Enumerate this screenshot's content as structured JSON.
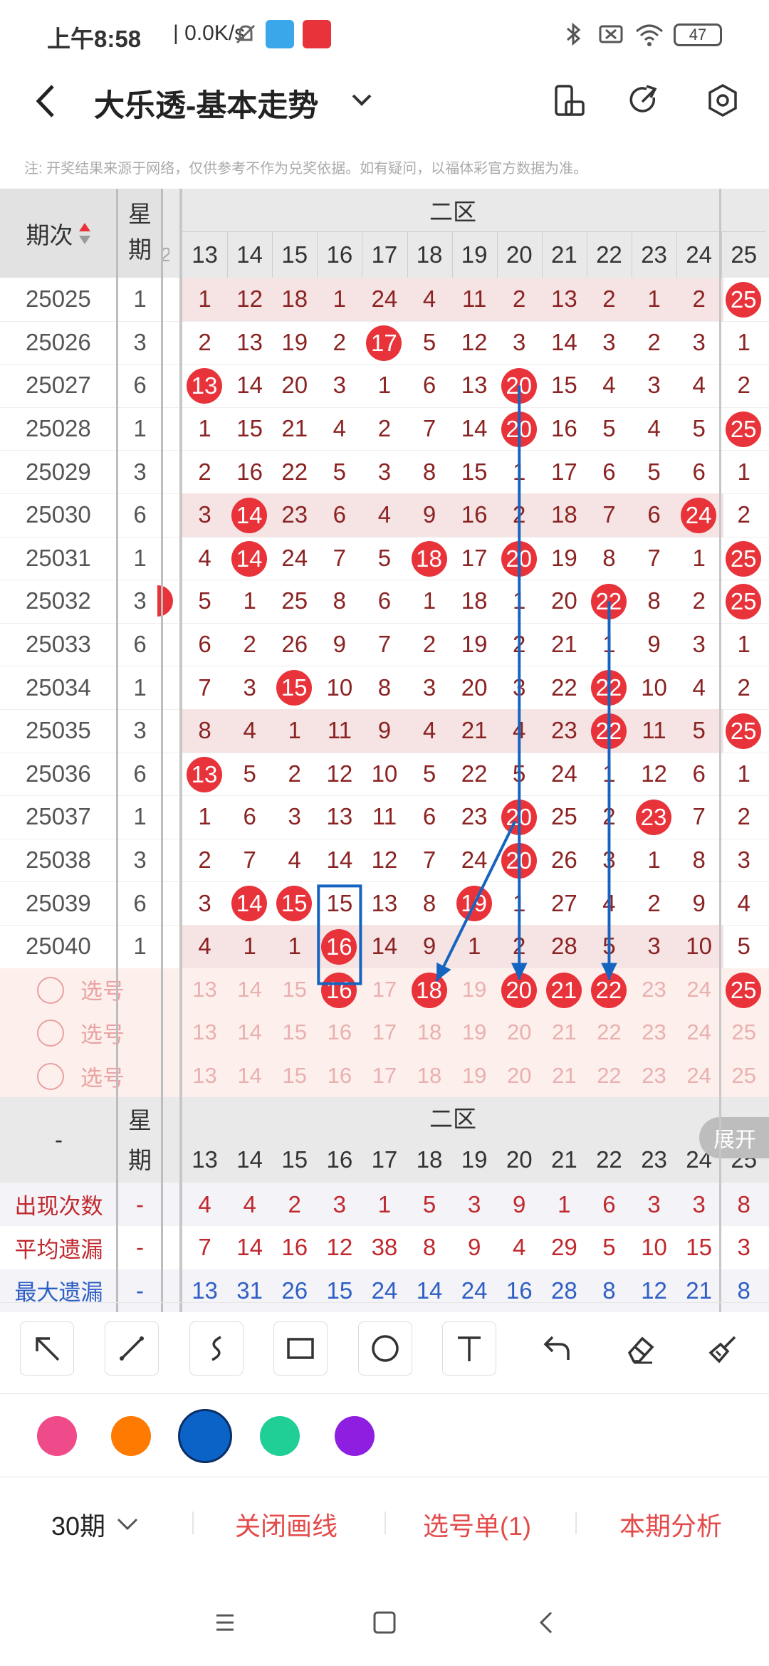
{
  "status": {
    "time": "上午8:58",
    "net": "| 0.0K/s",
    "battery": "47"
  },
  "header": {
    "title": "大乐透-基本走势"
  },
  "notice": "注: 开奖结果来源于网络，仅供参考不作为兑奖依据。如有疑问，以福体彩官方数据为准。",
  "table": {
    "col_period": "期次",
    "col_week_top": "星",
    "col_week_bottom": "期",
    "zone_label": "二区",
    "edge_left": "2",
    "columns": [
      "13",
      "14",
      "15",
      "16",
      "17",
      "18",
      "19",
      "20",
      "21",
      "22",
      "23",
      "24",
      "25"
    ],
    "rows": [
      {
        "period": "25025",
        "week": "1",
        "cells": [
          "1",
          "12",
          "18",
          "1",
          "24",
          "4",
          "11",
          "2",
          "13",
          "2",
          "1",
          "2",
          "25"
        ],
        "hits": [
          12
        ]
      },
      {
        "period": "25026",
        "week": "3",
        "cells": [
          "2",
          "13",
          "19",
          "2",
          "17",
          "5",
          "12",
          "3",
          "14",
          "3",
          "2",
          "3",
          "1"
        ],
        "hits": [
          4
        ]
      },
      {
        "period": "25027",
        "week": "6",
        "cells": [
          "13",
          "14",
          "20",
          "3",
          "1",
          "6",
          "13",
          "20",
          "15",
          "4",
          "3",
          "4",
          "2"
        ],
        "hits": [
          0,
          7
        ]
      },
      {
        "period": "25028",
        "week": "1",
        "cells": [
          "1",
          "15",
          "21",
          "4",
          "2",
          "7",
          "14",
          "20",
          "16",
          "5",
          "4",
          "5",
          "25"
        ],
        "hits": [
          7,
          12
        ]
      },
      {
        "period": "25029",
        "week": "3",
        "cells": [
          "2",
          "16",
          "22",
          "5",
          "3",
          "8",
          "15",
          "1",
          "17",
          "6",
          "5",
          "6",
          "1"
        ],
        "hits": []
      },
      {
        "period": "25030",
        "week": "6",
        "cells": [
          "3",
          "14",
          "23",
          "6",
          "4",
          "9",
          "16",
          "2",
          "18",
          "7",
          "6",
          "24",
          "2"
        ],
        "hits": [
          1,
          11
        ]
      },
      {
        "period": "25031",
        "week": "1",
        "cells": [
          "4",
          "14",
          "24",
          "7",
          "5",
          "18",
          "17",
          "20",
          "19",
          "8",
          "7",
          "1",
          "25"
        ],
        "hits": [
          1,
          5,
          7,
          12
        ]
      },
      {
        "period": "25032",
        "week": "3",
        "cells": [
          "5",
          "1",
          "25",
          "8",
          "6",
          "1",
          "18",
          "1",
          "20",
          "22",
          "8",
          "2",
          "25"
        ],
        "hits": [
          9,
          12
        ],
        "edge_hit": true
      },
      {
        "period": "25033",
        "week": "6",
        "cells": [
          "6",
          "2",
          "26",
          "9",
          "7",
          "2",
          "19",
          "2",
          "21",
          "1",
          "9",
          "3",
          "1"
        ],
        "hits": []
      },
      {
        "period": "25034",
        "week": "1",
        "cells": [
          "7",
          "3",
          "15",
          "10",
          "8",
          "3",
          "20",
          "3",
          "22",
          "22",
          "10",
          "4",
          "2"
        ],
        "hits": [
          2,
          9
        ]
      },
      {
        "period": "25035",
        "week": "3",
        "cells": [
          "8",
          "4",
          "1",
          "11",
          "9",
          "4",
          "21",
          "4",
          "23",
          "22",
          "11",
          "5",
          "25"
        ],
        "hits": [
          9,
          12
        ]
      },
      {
        "period": "25036",
        "week": "6",
        "cells": [
          "13",
          "5",
          "2",
          "12",
          "10",
          "5",
          "22",
          "5",
          "24",
          "1",
          "12",
          "6",
          "1"
        ],
        "hits": [
          0
        ]
      },
      {
        "period": "25037",
        "week": "1",
        "cells": [
          "1",
          "6",
          "3",
          "13",
          "11",
          "6",
          "23",
          "20",
          "25",
          "2",
          "23",
          "7",
          "2"
        ],
        "hits": [
          7,
          10
        ]
      },
      {
        "period": "25038",
        "week": "3",
        "cells": [
          "2",
          "7",
          "4",
          "14",
          "12",
          "7",
          "24",
          "20",
          "26",
          "3",
          "1",
          "8",
          "3"
        ],
        "hits": [
          7
        ]
      },
      {
        "period": "25039",
        "week": "6",
        "cells": [
          "3",
          "14",
          "15",
          "15",
          "13",
          "8",
          "19",
          "1",
          "27",
          "4",
          "2",
          "9",
          "4"
        ],
        "hits": [
          1,
          2,
          6
        ]
      },
      {
        "period": "25040",
        "week": "1",
        "cells": [
          "4",
          "1",
          "1",
          "16",
          "14",
          "9",
          "1",
          "2",
          "28",
          "5",
          "3",
          "10",
          "5"
        ],
        "hits": [
          3
        ]
      }
    ],
    "pick_label": "选号",
    "pick_rows": [
      {
        "hits": [
          3,
          5,
          7,
          8,
          9,
          12
        ]
      },
      {
        "hits": []
      },
      {
        "hits": []
      }
    ],
    "footer_period": "-",
    "expand_label": "展开",
    "stats": [
      {
        "label": "出现次数",
        "week": "-",
        "values": [
          "4",
          "4",
          "2",
          "3",
          "1",
          "5",
          "3",
          "9",
          "1",
          "6",
          "3",
          "3",
          "8"
        ],
        "color": "#c0282d"
      },
      {
        "label": "平均遗漏",
        "week": "-",
        "values": [
          "7",
          "14",
          "16",
          "12",
          "38",
          "8",
          "9",
          "4",
          "29",
          "5",
          "10",
          "15",
          "3"
        ],
        "color": "#c0282d"
      },
      {
        "label": "最大遗漏",
        "week": "-",
        "values": [
          "13",
          "31",
          "26",
          "15",
          "24",
          "14",
          "24",
          "16",
          "28",
          "8",
          "12",
          "21",
          "8"
        ],
        "color": "#2f5fc4"
      }
    ],
    "stats_edge": "5"
  },
  "colors": {
    "accent_red": "#e8333a",
    "draw_blue": "#1565c0",
    "swatches": [
      "#ef4a8a",
      "#ff7a00",
      "#0b63c7",
      "#1fcf95",
      "#8e1fe0"
    ],
    "selected_swatch": 2
  },
  "bottom": {
    "periods": "30期",
    "close_draw": "关闭画线",
    "pick_list": "选号单(1)",
    "analysis": "本期分析"
  }
}
